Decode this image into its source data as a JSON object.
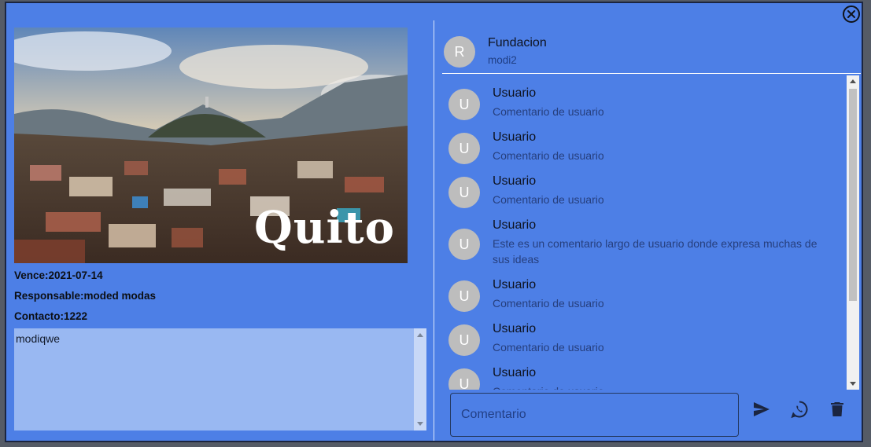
{
  "modal": {
    "close_icon": "close-circle-icon"
  },
  "event": {
    "image_caption": "Quito",
    "expires": "Vence:2021-07-14",
    "responsible": "Responsable:moded modas",
    "contact": "Contacto:1222",
    "description": "modiqwe"
  },
  "header": {
    "avatar_initial": "R",
    "name": "Fundacion",
    "subtitle": "modi2"
  },
  "comments": [
    {
      "initial": "U",
      "user": "Usuario",
      "text": "Comentario de usuario"
    },
    {
      "initial": "U",
      "user": "Usuario",
      "text": "Comentario de usuario"
    },
    {
      "initial": "U",
      "user": "Usuario",
      "text": "Comentario de usuario"
    },
    {
      "initial": "U",
      "user": "Usuario",
      "text": "Este es un comentario largo de usuario donde expresa muchas de sus ideas"
    },
    {
      "initial": "U",
      "user": "Usuario",
      "text": "Comentario de usuario"
    },
    {
      "initial": "U",
      "user": "Usuario",
      "text": "Comentario de usuario"
    },
    {
      "initial": "U",
      "user": "Usuario",
      "text": "Comentario de usuario"
    }
  ],
  "composer": {
    "placeholder": "Comentario",
    "send_icon": "send-icon",
    "whatsapp_icon": "whatsapp-icon",
    "delete_icon": "trash-icon"
  },
  "colors": {
    "modal_bg": "#4d7fe6",
    "textarea_bg": "#99b8f2",
    "avatar_bg": "#bdbdbd"
  }
}
